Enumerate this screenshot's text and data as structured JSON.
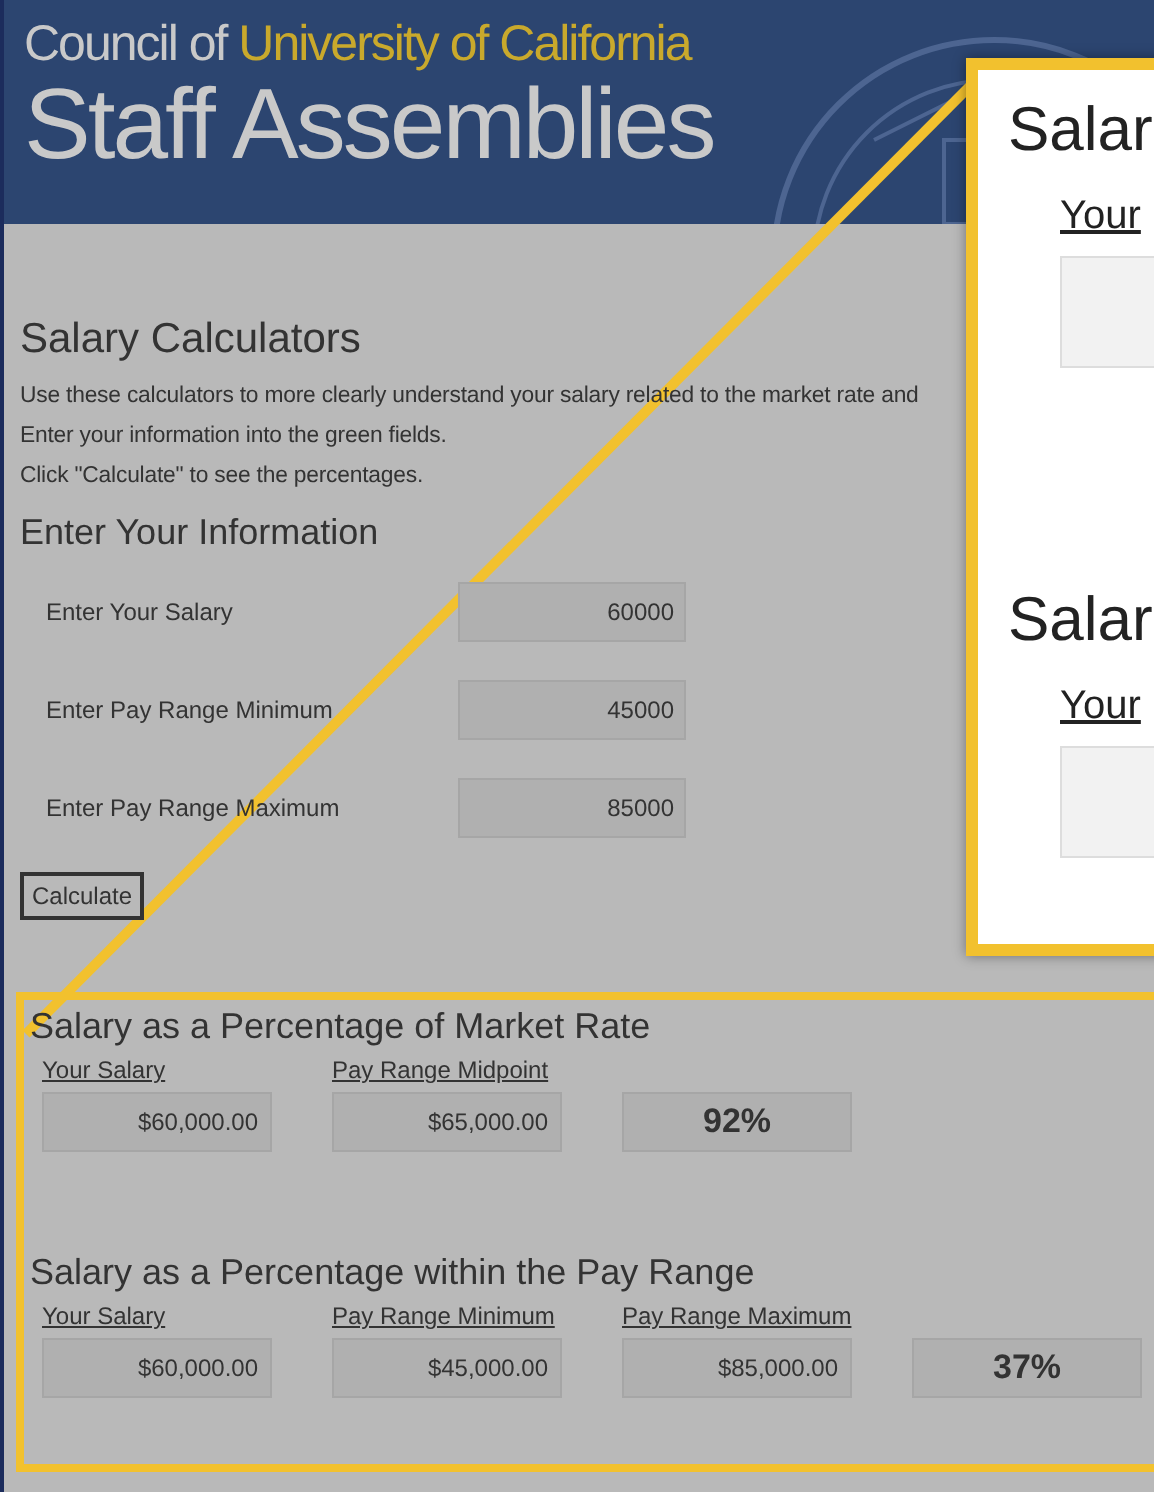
{
  "header": {
    "line1_plain": "Council of",
    "line1_accent": "University of California",
    "line2": "Staff Assemblies"
  },
  "title": "Salary Calculators",
  "intro": [
    "Use these calculators to more clearly understand your salary related to the market rate and",
    "Enter your information into the green fields.",
    "Click \"Calculate\" to see the percentages."
  ],
  "inputs_heading": "Enter Your Information",
  "inputs": [
    {
      "label": "Enter Your Salary",
      "value": "60000"
    },
    {
      "label": "Enter Pay Range Minimum",
      "value": "45000"
    },
    {
      "label": "Enter Pay Range Maximum",
      "value": "85000"
    }
  ],
  "calculate_button": "Calculate",
  "results": [
    {
      "heading": "Salary as a Percentage of Market Rate",
      "fields": [
        {
          "label": "Your Salary",
          "value": "$60,000.00"
        },
        {
          "label": "Pay Range Midpoint",
          "value": "$65,000.00"
        }
      ],
      "percentage": "92%"
    },
    {
      "heading": "Salary as a Percentage within the Pay Range",
      "fields": [
        {
          "label": "Your Salary",
          "value": "$60,000.00"
        },
        {
          "label": "Pay Range Minimum",
          "value": "$45,000.00"
        },
        {
          "label": "Pay Range Maximum",
          "value": "$85,000.00"
        }
      ],
      "percentage": "37%"
    }
  ],
  "callout": {
    "sections": [
      {
        "heading": "Salar",
        "label": "Your"
      },
      {
        "heading": "Salar",
        "label": "Your"
      }
    ]
  }
}
